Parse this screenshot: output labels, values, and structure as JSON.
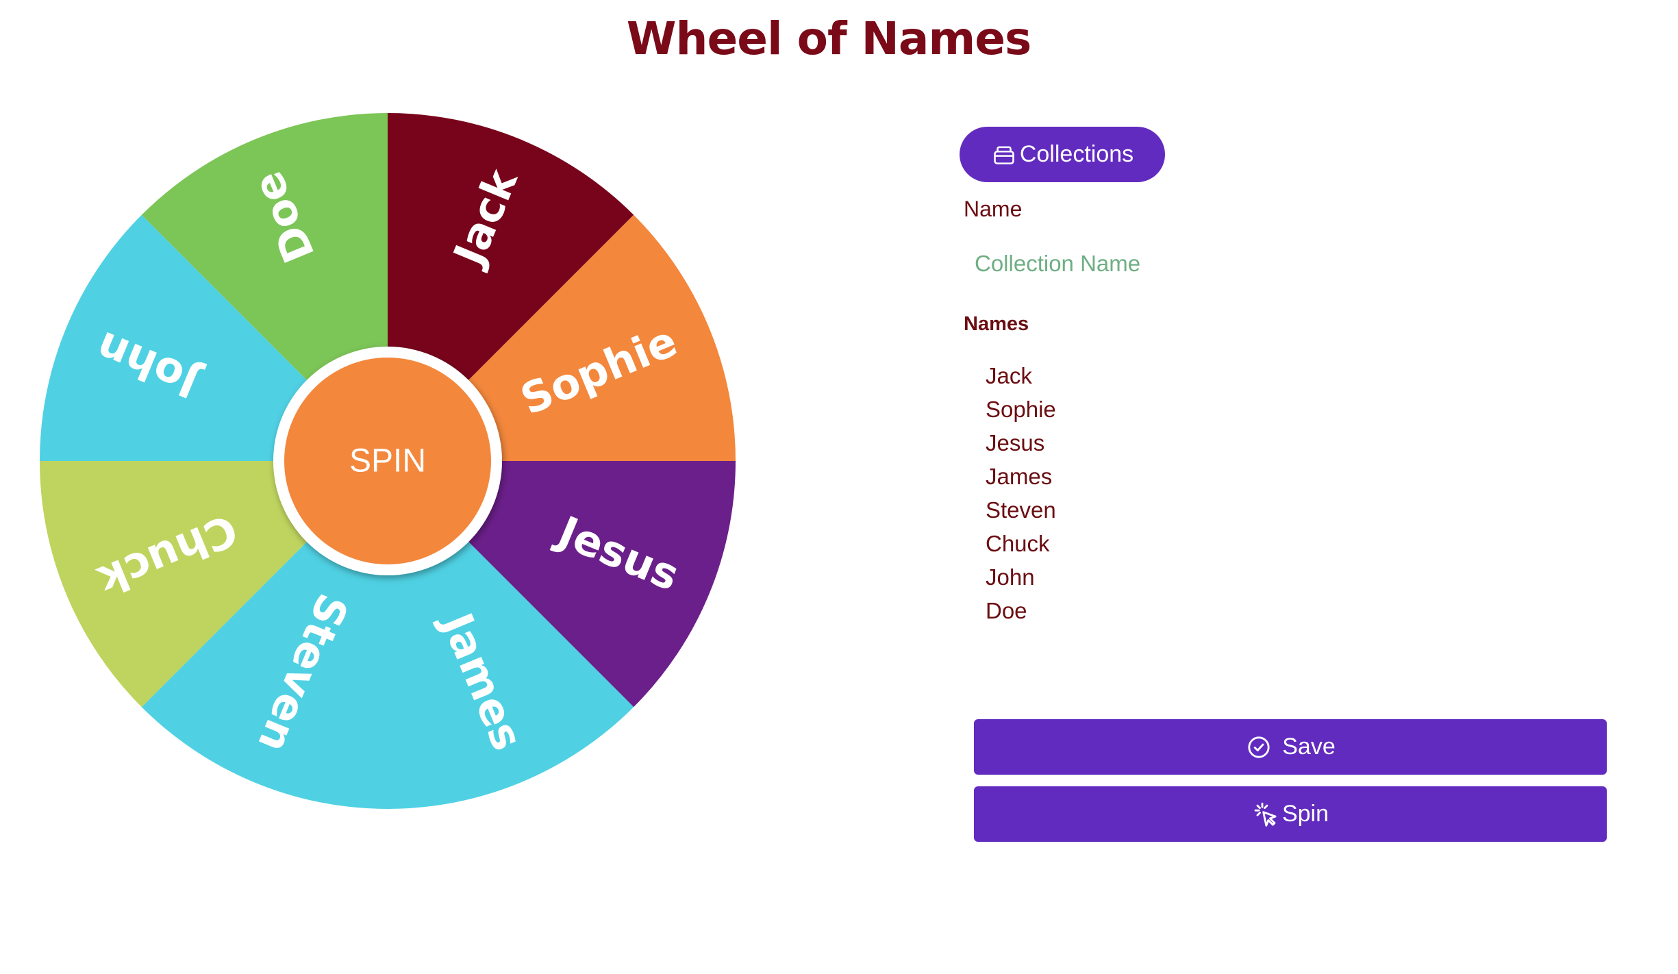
{
  "page": {
    "title": "Wheel of Names"
  },
  "wheel": {
    "hub_label": "SPIN",
    "hub_color": "#f3873c",
    "segments": [
      {
        "label": "Jack",
        "color": "#78041b"
      },
      {
        "label": "Sophie",
        "color": "#f3873c"
      },
      {
        "label": "Jesus",
        "color": "#6b1f8a"
      },
      {
        "label": "James",
        "color": "#4fd1e3"
      },
      {
        "label": "Steven",
        "color": "#4fd1e3"
      },
      {
        "label": "Chuck",
        "color": "#bfd45f"
      },
      {
        "label": "John",
        "color": "#4fd1e3"
      },
      {
        "label": "Doe",
        "color": "#7cc557"
      }
    ]
  },
  "panel": {
    "collections_label": "Collections",
    "name_label": "Name",
    "name_placeholder": "Collection Name",
    "name_value": "",
    "names_label": "Names",
    "names": [
      "Jack",
      "Sophie",
      "Jesus",
      "James",
      "Steven",
      "Chuck",
      "John",
      "Doe"
    ],
    "save_label": "Save",
    "spin_label": "Spin"
  },
  "colors": {
    "accent": "#622bbf",
    "text": "#6b0e12",
    "title": "#7a0a18",
    "placeholder": "#6fae84"
  },
  "icons": {
    "collections": "archive-box-icon",
    "save": "check-circle-icon",
    "spin": "cursor-click-icon"
  }
}
